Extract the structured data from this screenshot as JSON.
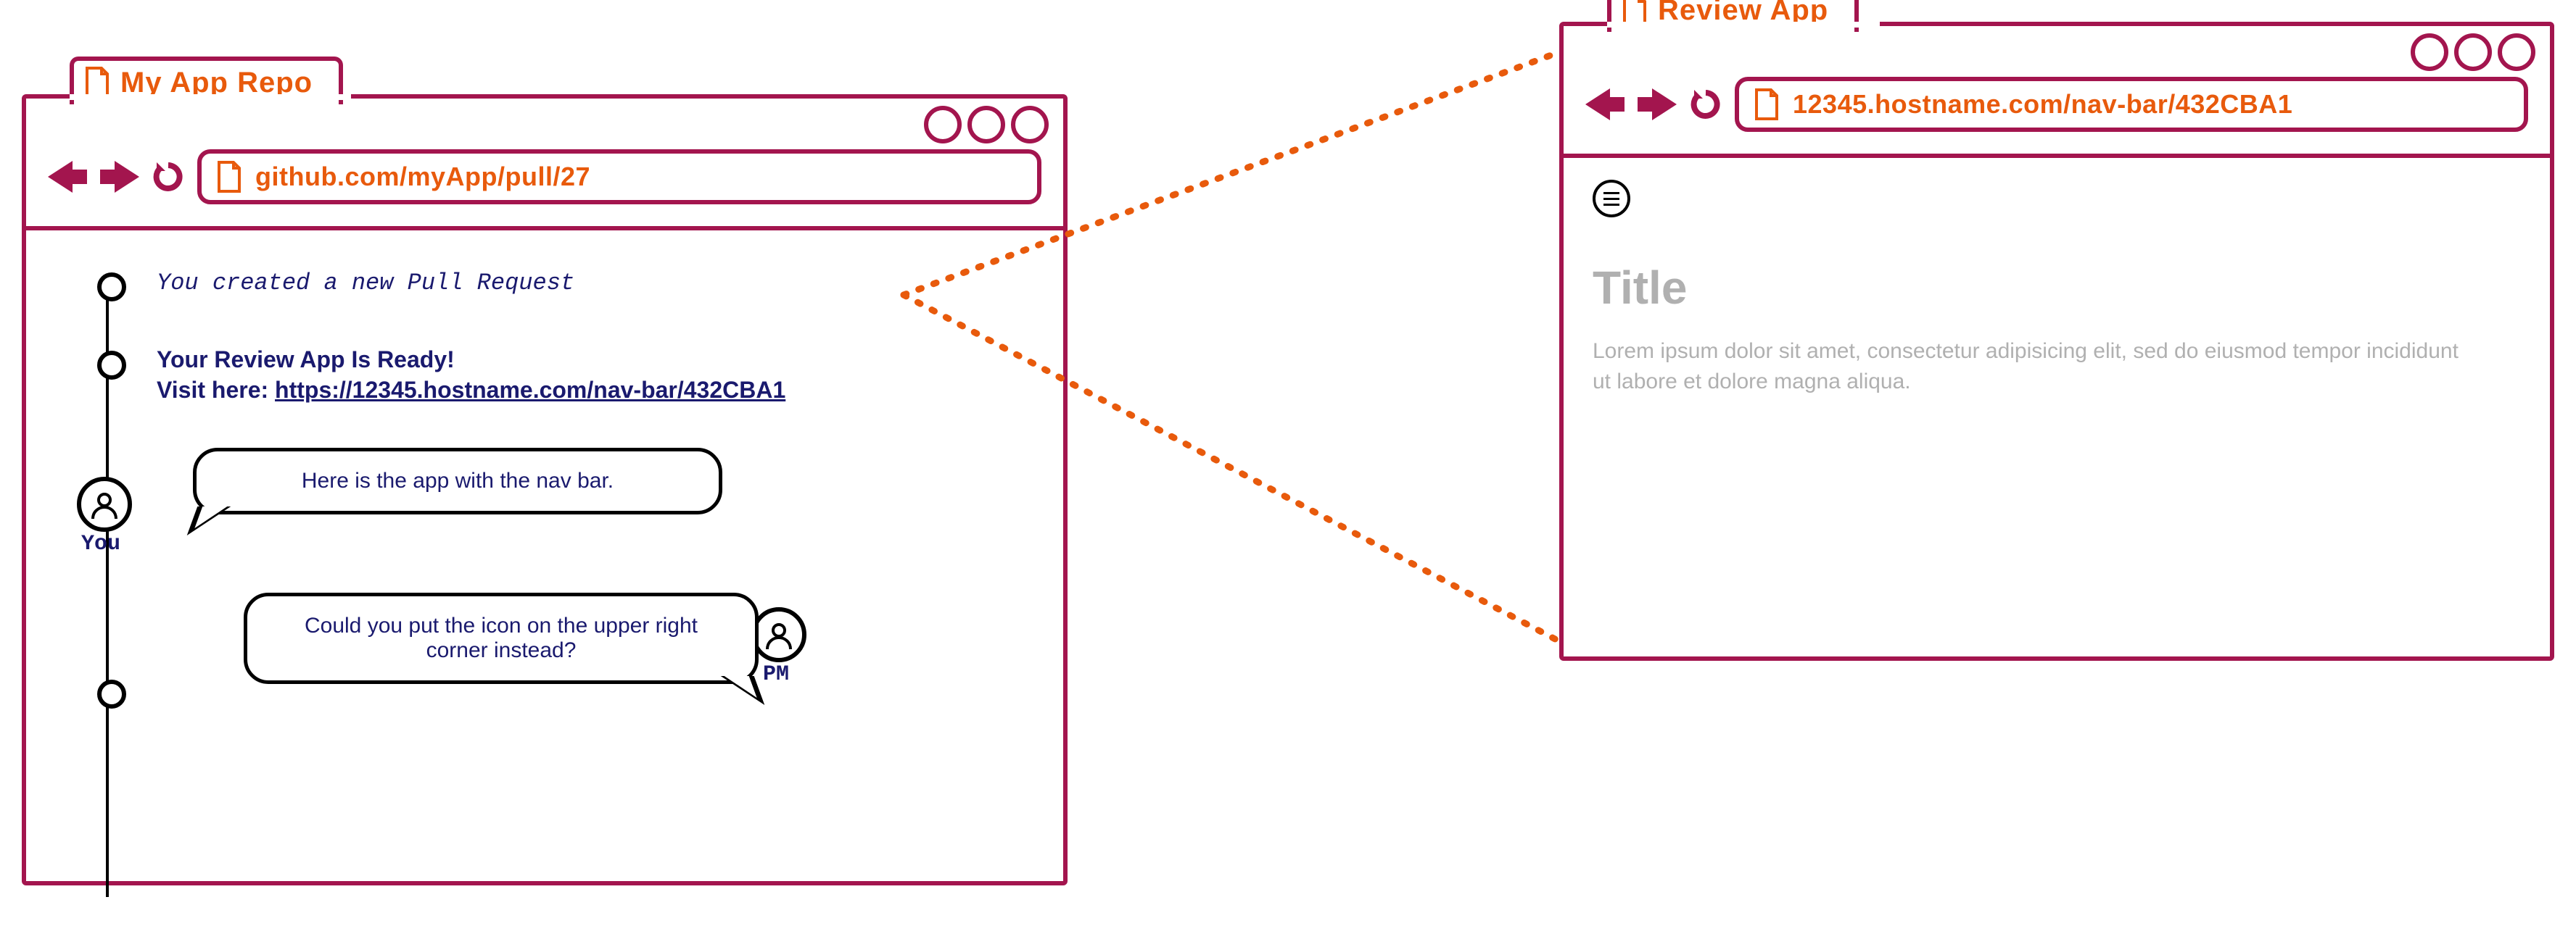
{
  "left_window": {
    "tab_title": "My App Repo",
    "url": "github.com/myApp/pull/27",
    "timeline": {
      "created_text": "You created a new Pull Request",
      "ready_heading": "Your Review App Is Ready!",
      "visit_prefix": "Visit here: ",
      "visit_link_text": "https://12345.hostname.com/nav-bar/432CBA1"
    },
    "comments": {
      "you_label": "You",
      "you_text": "Here is the app with the nav bar.",
      "pm_label": "PM",
      "pm_text": "Could you put the icon on the upper right corner instead?"
    }
  },
  "right_window": {
    "tab_title": "Review App",
    "url": "12345.hostname.com/nav-bar/432CBA1",
    "placeholder_title": "Title",
    "placeholder_body": "Lorem ipsum dolor sit amet, consectetur adipisicing elit, sed do eiusmod tempor incididunt ut labore et dolore magna aliqua."
  }
}
